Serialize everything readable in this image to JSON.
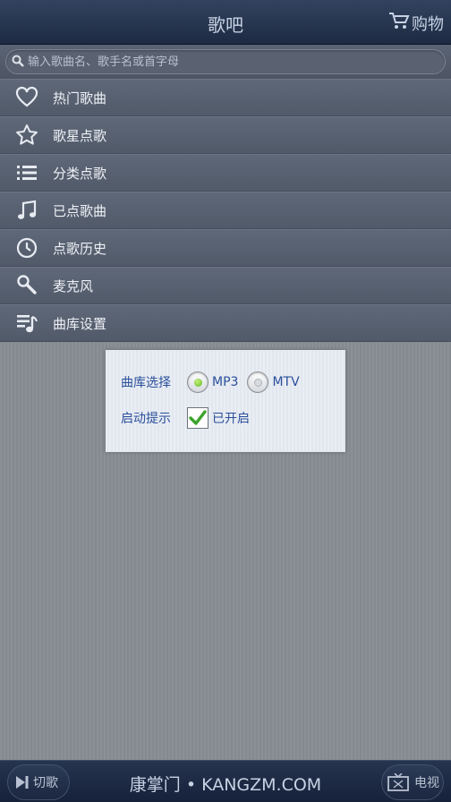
{
  "header": {
    "title": "歌吧",
    "cart_label": "购物"
  },
  "search": {
    "placeholder": "输入歌曲名、歌手名或首字母"
  },
  "menu": {
    "items": [
      {
        "label": "热门歌曲",
        "icon": "heart-icon"
      },
      {
        "label": "歌星点歌",
        "icon": "star-icon"
      },
      {
        "label": "分类点歌",
        "icon": "list-icon"
      },
      {
        "label": "已点歌曲",
        "icon": "music-note-icon"
      },
      {
        "label": "点歌历史",
        "icon": "clock-icon"
      },
      {
        "label": "麦克风",
        "icon": "microphone-icon"
      },
      {
        "label": "曲库设置",
        "icon": "playlist-settings-icon"
      }
    ]
  },
  "dialog": {
    "library_label": "曲库选择",
    "option_mp3": "MP3",
    "option_mtv": "MTV",
    "selected": "MP3",
    "prompt_label": "启动提示",
    "prompt_value": "已开启",
    "prompt_checked": true
  },
  "footer": {
    "left_button": "切歌",
    "brand": "康掌门 • KANGZM.COM",
    "right_button": "电视"
  },
  "colors": {
    "header_bg": "#1d2a42",
    "menu_bg": "#565f6e",
    "dialog_text": "#2a4f9a",
    "radio_selected": "#5ab822",
    "check_green": "#3aa32a"
  }
}
